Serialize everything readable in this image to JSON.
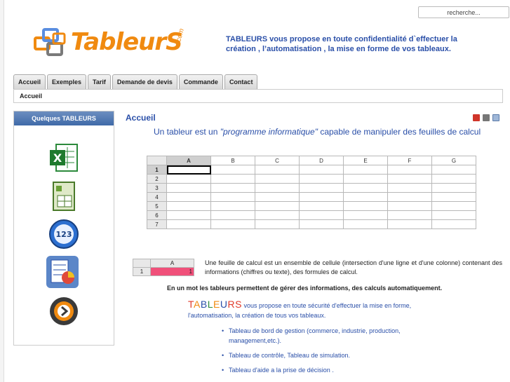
{
  "search": {
    "value": "recherche..."
  },
  "logo": {
    "name": "TableurS",
    "com": ".com"
  },
  "tagline": "TABLEURS vous propose en toute confidentialité d`effectuer la création , l’automatisation , la mise en forme de vos tableaux.",
  "nav": {
    "tabs": [
      {
        "label": "Accueil"
      },
      {
        "label": "Exemples"
      },
      {
        "label": "Tarif"
      },
      {
        "label": "Demande de devis"
      },
      {
        "label": "Commande"
      },
      {
        "label": "Contact"
      }
    ],
    "breadcrumb": "Accueil"
  },
  "sidebar": {
    "title": "Quelques TABLEURS",
    "icons": [
      "excel-icon",
      "spreadsheet-icon",
      "numbers-icon",
      "chart-sheet-icon",
      "app-icon"
    ]
  },
  "main": {
    "title": "Accueil",
    "tools": [
      "pdf-icon",
      "print-icon",
      "email-icon"
    ],
    "intro_before": "Un tableur est un ",
    "intro_em": "\"programme informatique\"",
    "intro_after": " capable de manipuler des feuilles de calcul",
    "sheet": {
      "columns": [
        "A",
        "B",
        "C",
        "D",
        "E",
        "F",
        "G"
      ],
      "rows": [
        "1",
        "2",
        "3",
        "4",
        "5",
        "6",
        "7"
      ]
    },
    "mini_sheet": {
      "column": "A",
      "row": "1",
      "value": "1"
    },
    "description": "Une feuille de calcul est un ensemble de cellule (intersection d'une ligne et d'une colonne) contenant des informations (chiffres ou texte), des formules de calcul.",
    "summary": "En un mot les tableurs permettent de gérer des informations, des calculs automatiquement.",
    "promo_rest": " vous propose en toute sécurité d'effectuer la mise en forme, l'automatisation, la création de tous vos tableaux.",
    "bullets": [
      "Tableau de bord de gestion (commerce, industrie, production, management,etc.).",
      "Tableau de contrôle, Tableau de simulation.",
      "Tableau d'aide a la prise de décision ."
    ]
  },
  "colors": {
    "brand_orange": "#f08a10",
    "link_blue": "#2a4fa8",
    "sidebar_header": "#3f6aa8",
    "mini_cell": "#f0507a"
  }
}
